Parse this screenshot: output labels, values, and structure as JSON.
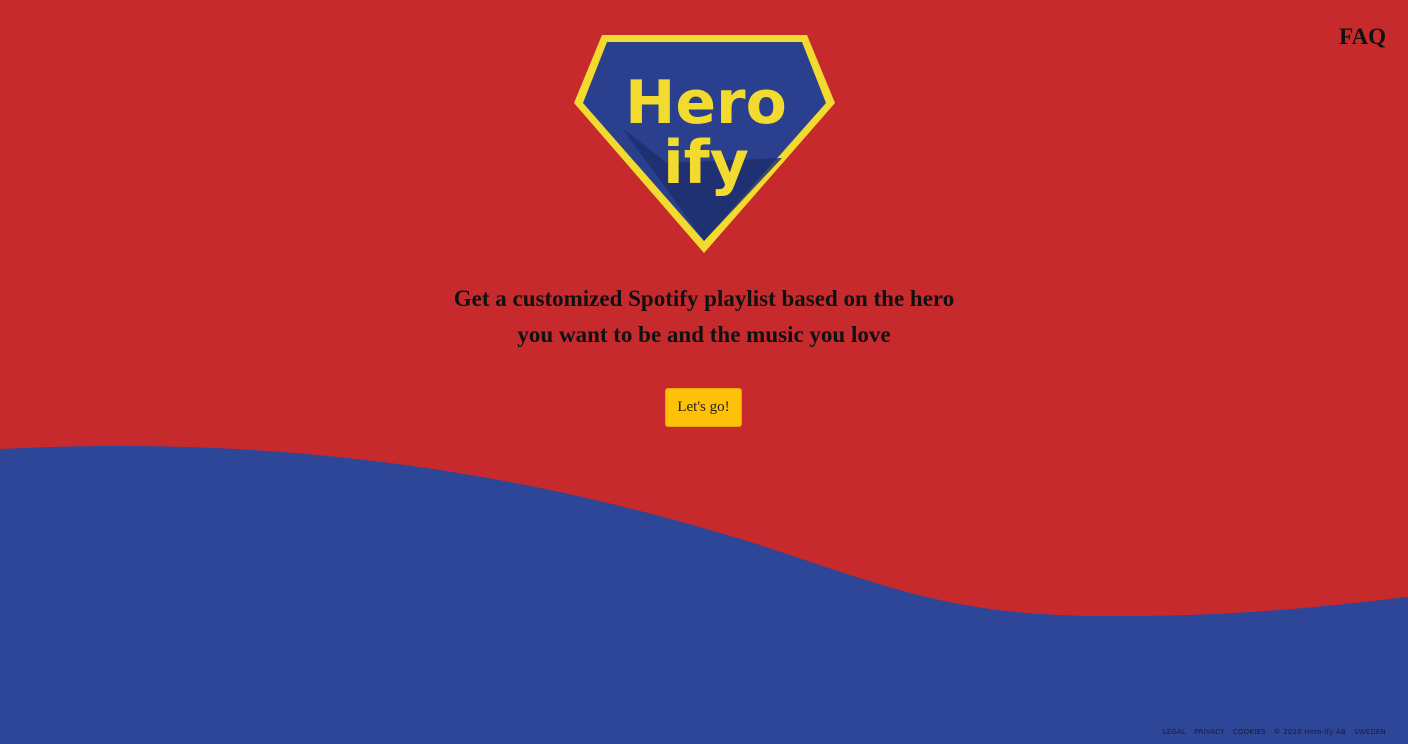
{
  "nav": {
    "faq_label": "FAQ"
  },
  "logo": {
    "line1": "Hero",
    "line2": "ify"
  },
  "hero": {
    "tagline_line1": "Get a customized Spotify playlist based on the hero",
    "tagline_line2": "you want to be and the music you love",
    "cta_label": "Let's go!"
  },
  "footer": {
    "legal": "LEGAL",
    "privacy": "PRIVACY",
    "cookies": "COOKIES",
    "copyright": "© 2020 Hero-ify AB",
    "country": "SWEDEN"
  },
  "colors": {
    "background_red": "#c62a2d",
    "wave_blue": "#2e4697",
    "logo_blue": "#2b3f8f",
    "logo_gold": "#f2db2e",
    "button_yellow": "#ffc107"
  }
}
